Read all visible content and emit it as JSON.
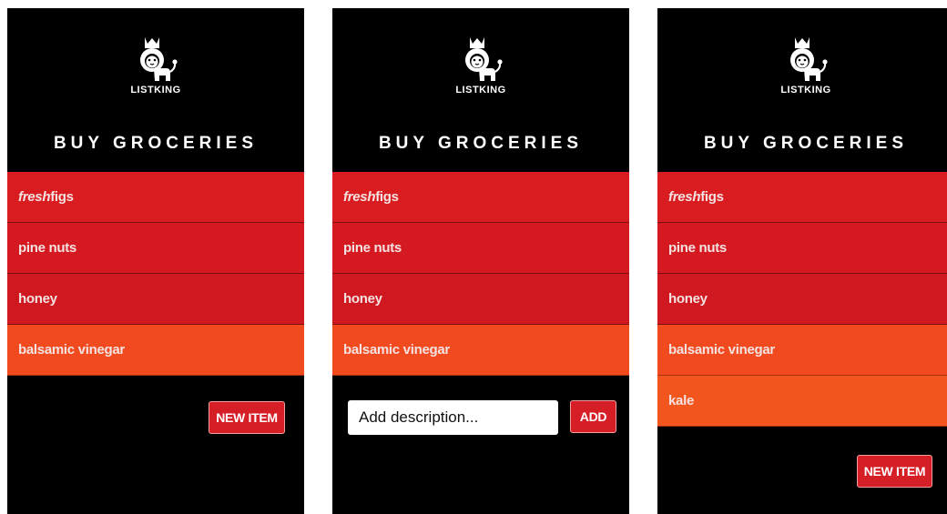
{
  "app": {
    "brand": "LISTKING",
    "icon": "crowned-lion-logo"
  },
  "list": {
    "title": "BUY GROCERIES"
  },
  "screens": [
    {
      "items": [
        {
          "em": "fresh",
          "text": "figs"
        },
        {
          "em": "",
          "text": "pine nuts"
        },
        {
          "em": "",
          "text": "honey"
        },
        {
          "em": "",
          "text": "balsamic vinegar"
        }
      ],
      "new_item_label": "NEW ITEM"
    },
    {
      "items": [
        {
          "em": "fresh",
          "text": "figs"
        },
        {
          "em": "",
          "text": "pine nuts"
        },
        {
          "em": "",
          "text": "honey"
        },
        {
          "em": "",
          "text": "balsamic vinegar"
        }
      ],
      "input_placeholder": "Add description...",
      "add_label": "ADD"
    },
    {
      "items": [
        {
          "em": "fresh",
          "text": "figs"
        },
        {
          "em": "",
          "text": "pine nuts"
        },
        {
          "em": "",
          "text": "honey"
        },
        {
          "em": "",
          "text": "balsamic vinegar"
        },
        {
          "em": "",
          "text": "kale"
        }
      ],
      "new_item_label": "NEW ITEM"
    }
  ],
  "colors": {
    "background": "#000000",
    "item_red": "#d91c20",
    "item_orange": "#f04a1e",
    "button_red": "#d61e26",
    "text": "#ffffff"
  }
}
